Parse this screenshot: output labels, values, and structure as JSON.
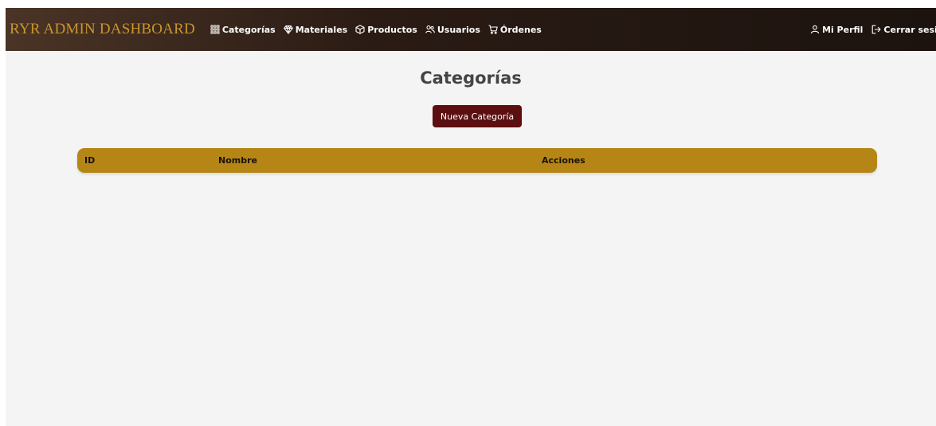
{
  "navbar": {
    "brand": "RYR ADMIN DASHBOARD",
    "brand_color": "#c9962a",
    "links": [
      {
        "label": "Categorías",
        "icon": "grid-icon"
      },
      {
        "label": "Materiales",
        "icon": "gem-icon"
      },
      {
        "label": "Productos",
        "icon": "box-icon"
      },
      {
        "label": "Usuarios",
        "icon": "users-icon"
      },
      {
        "label": "Órdenes",
        "icon": "cart-icon"
      }
    ],
    "right": [
      {
        "label": "Mi Perfil",
        "icon": "user-icon"
      },
      {
        "label": "Cerrar sesión",
        "icon": "logout-icon"
      }
    ]
  },
  "main": {
    "title": "Categorías",
    "new_button_label": "Nueva Categoría",
    "button_color": "#5c0f10",
    "table": {
      "header_color": "#b58615",
      "columns": [
        "ID",
        "Nombre",
        "Acciones"
      ],
      "rows": []
    }
  }
}
